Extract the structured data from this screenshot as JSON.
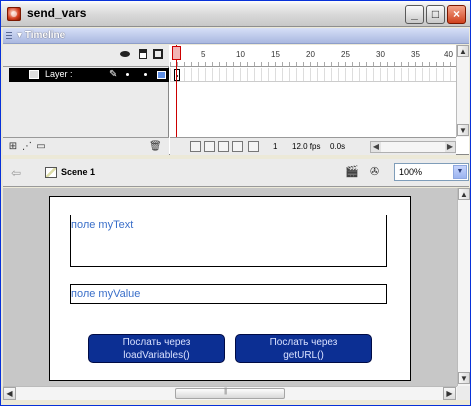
{
  "window": {
    "title": "send_vars",
    "controls": {
      "minimize": "_",
      "maximize": "□",
      "close": "×"
    }
  },
  "timeline": {
    "title": "Timeline",
    "collapse_glyph": "▾",
    "ruler": [
      "1",
      "5",
      "10",
      "15",
      "20",
      "25",
      "30",
      "35",
      "40"
    ],
    "layers": [
      {
        "name": "Layer :",
        "color": "#5d8ee5"
      }
    ],
    "status": {
      "frame": "1",
      "fps": "12.0 fps",
      "time": "0.0s"
    }
  },
  "editbar": {
    "scene": "Scene 1",
    "zoom": "100%"
  },
  "stage": {
    "field1_label": "поле myText",
    "field2_label": "поле myValue",
    "button1": {
      "line1": "Послать через",
      "line2": "loadVariables()"
    },
    "button2": {
      "line1": "Послать через",
      "line2": "getURL()"
    }
  },
  "colors": {
    "accent": "#0c2f93",
    "field_label": "#3a6fc9",
    "stage_bg": "#c7c7c7"
  }
}
